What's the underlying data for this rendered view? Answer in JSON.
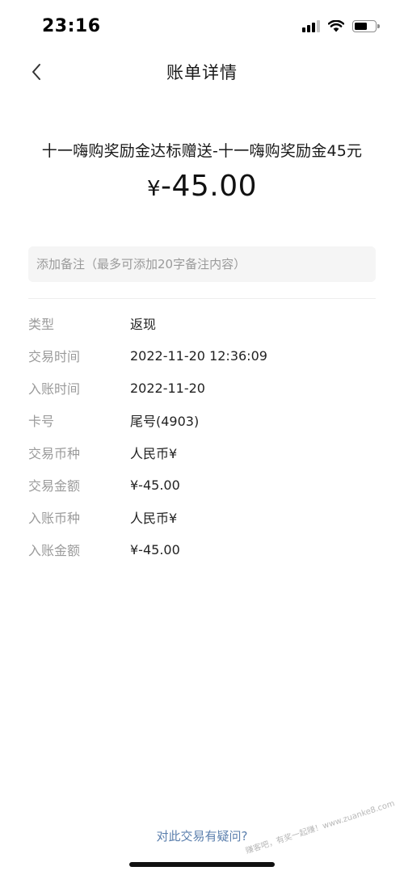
{
  "status_bar": {
    "time": "23:16"
  },
  "nav": {
    "title": "账单详情"
  },
  "summary": {
    "title": "十一嗨购奖励金达标赠送-十一嗨购奖励金45元",
    "currency_symbol": "¥",
    "amount": "-45.00"
  },
  "note": {
    "placeholder": "添加备注（最多可添加20字备注内容）"
  },
  "details": [
    {
      "label": "类型",
      "value": "返现"
    },
    {
      "label": "交易时间",
      "value": "2022-11-20 12:36:09"
    },
    {
      "label": "入账时间",
      "value": "2022-11-20"
    },
    {
      "label": "卡号",
      "value": "尾号(4903)"
    },
    {
      "label": "交易币种",
      "value": "人民币¥"
    },
    {
      "label": "交易金额",
      "value": "¥-45.00"
    },
    {
      "label": "入账币种",
      "value": "人民币¥"
    },
    {
      "label": "入账金额",
      "value": "¥-45.00"
    }
  ],
  "footer": {
    "help_link": "对此交易有疑问?"
  },
  "watermark": "赚客吧，有奖一起赚！www.zuanke8.com"
}
